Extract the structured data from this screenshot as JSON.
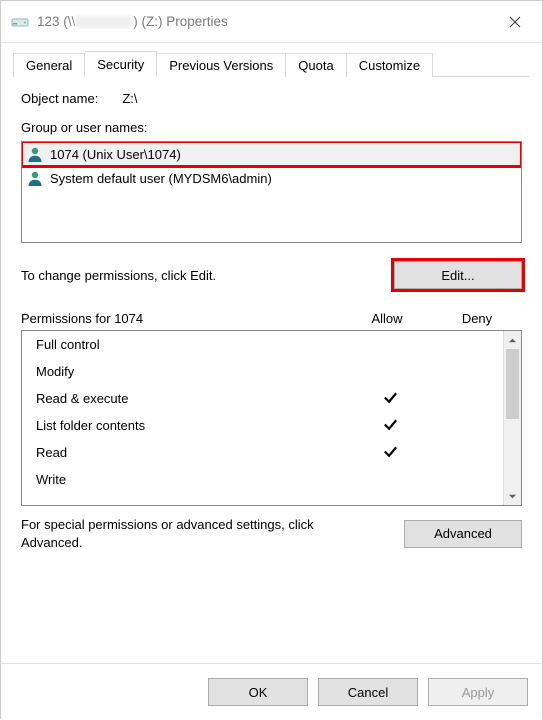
{
  "titlebar": {
    "prefix": "123 (\\\\",
    "suffix": ") (Z:) Properties"
  },
  "tabs": [
    "General",
    "Security",
    "Previous Versions",
    "Quota",
    "Customize"
  ],
  "active_tab": "Security",
  "object_name_label": "Object name:",
  "object_name_value": "Z:\\",
  "group_label": "Group or user names:",
  "users": [
    {
      "name": "1074 (Unix User\\1074)",
      "selected": true
    },
    {
      "name": "System default user (MYDSM6\\admin)",
      "selected": false
    }
  ],
  "edit_hint": "To change permissions, click Edit.",
  "edit_button": "Edit...",
  "perm_header_label": "Permissions for 1074",
  "perm_allow": "Allow",
  "perm_deny": "Deny",
  "permissions": [
    {
      "name": "Full control",
      "allow": false,
      "deny": false
    },
    {
      "name": "Modify",
      "allow": false,
      "deny": false
    },
    {
      "name": "Read & execute",
      "allow": true,
      "deny": false
    },
    {
      "name": "List folder contents",
      "allow": true,
      "deny": false
    },
    {
      "name": "Read",
      "allow": true,
      "deny": false
    },
    {
      "name": "Write",
      "allow": false,
      "deny": false
    }
  ],
  "advanced_hint": "For special permissions or advanced settings, click Advanced.",
  "advanced_button": "Advanced",
  "footer": {
    "ok": "OK",
    "cancel": "Cancel",
    "apply": "Apply"
  }
}
